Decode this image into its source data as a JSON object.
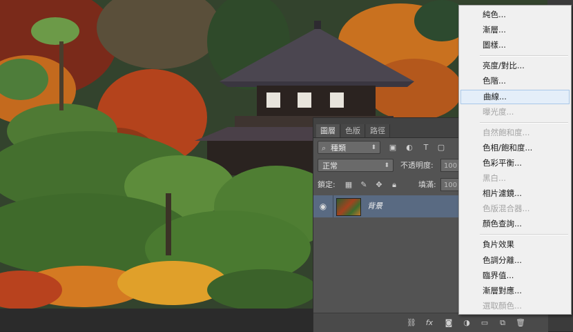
{
  "layers_panel": {
    "tabs": [
      {
        "label": "圖層",
        "active": true
      },
      {
        "label": "色版",
        "active": false
      },
      {
        "label": "路徑",
        "active": false
      }
    ],
    "filter_kind": "種類",
    "blend_mode": "正常",
    "opacity_label": "不透明度:",
    "opacity_value": "100",
    "lock_label": "鎖定:",
    "fill_label": "填滿:",
    "fill_value": "100",
    "layer": {
      "name": "背景",
      "visible": true
    }
  },
  "adjustment_menu": {
    "groups": [
      [
        {
          "label": "純色...",
          "enabled": true
        },
        {
          "label": "漸層...",
          "enabled": true
        },
        {
          "label": "圖樣...",
          "enabled": true
        }
      ],
      [
        {
          "label": "亮度/對比...",
          "enabled": true
        },
        {
          "label": "色階...",
          "enabled": true
        },
        {
          "label": "曲線...",
          "enabled": true,
          "highlighted": true
        },
        {
          "label": "曝光度...",
          "enabled": false
        }
      ],
      [
        {
          "label": "自然飽和度...",
          "enabled": false
        },
        {
          "label": "色相/飽和度...",
          "enabled": true
        },
        {
          "label": "色彩平衡...",
          "enabled": true
        },
        {
          "label": "黑白...",
          "enabled": false
        },
        {
          "label": "相片濾鏡...",
          "enabled": true
        },
        {
          "label": "色版混合器...",
          "enabled": false
        },
        {
          "label": "顏色查詢...",
          "enabled": true
        }
      ],
      [
        {
          "label": "負片效果",
          "enabled": true
        },
        {
          "label": "色調分離...",
          "enabled": true
        },
        {
          "label": "臨界值...",
          "enabled": true
        },
        {
          "label": "漸層對應...",
          "enabled": true
        },
        {
          "label": "選取顏色...",
          "enabled": false
        }
      ]
    ]
  },
  "colors": {
    "panel_bg": "#535353",
    "selected_layer": "#596a82",
    "menu_bg": "#f0f0f0",
    "menu_hover": "#e4eef9"
  }
}
